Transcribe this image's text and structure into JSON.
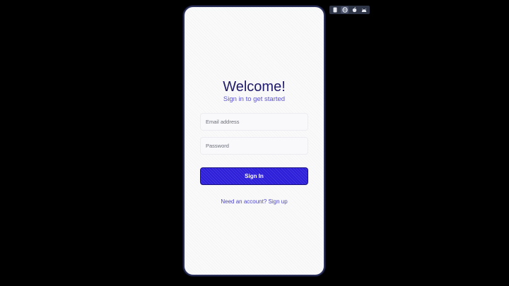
{
  "login": {
    "title": "Welcome!",
    "subtitle": "Sign in to get started",
    "email_placeholder": "Email address",
    "password_placeholder": "Password",
    "signin_label": "Sign In",
    "signup_link": "Need an account? Sign up"
  },
  "toolbar": {
    "items": [
      {
        "icon": "phone-icon",
        "active": false
      },
      {
        "icon": "globe-icon",
        "active": true
      },
      {
        "icon": "apple-icon",
        "active": false
      },
      {
        "icon": "android-icon",
        "active": false
      }
    ]
  },
  "colors": {
    "background": "#000000",
    "card": "#fafafb",
    "title": "#1f1a6b",
    "accent": "#5b54d6",
    "button": "#2d1fd9",
    "toolbar": "#2e3547"
  }
}
